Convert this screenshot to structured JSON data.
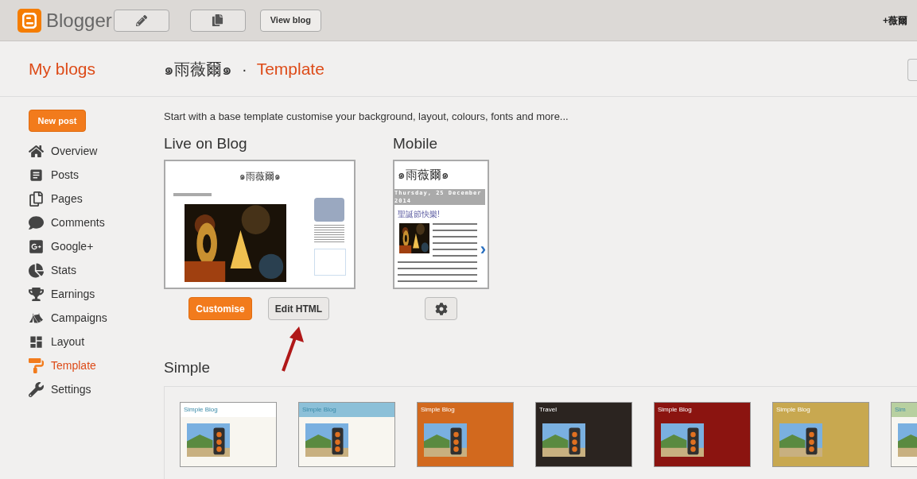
{
  "top_bar": {
    "logo_text": "Blogger",
    "buttons": [
      {
        "kind": "pencil"
      },
      {
        "kind": "pages"
      },
      {
        "kind": "text",
        "label": "View blog"
      }
    ],
    "user": "+薇爾"
  },
  "header": {
    "my_blogs": "My blogs",
    "blog_name": "๑雨薇爾๑",
    "separator": "·",
    "page_title": "Template"
  },
  "sidebar": {
    "new_post": "New post",
    "items": [
      {
        "label": "Overview",
        "selected": false
      },
      {
        "label": "Posts",
        "selected": false
      },
      {
        "label": "Pages",
        "selected": false
      },
      {
        "label": "Comments",
        "selected": false
      },
      {
        "label": "Google+",
        "selected": false
      },
      {
        "label": "Stats",
        "selected": false
      },
      {
        "label": "Earnings",
        "selected": false
      },
      {
        "label": "Campaigns",
        "selected": false
      },
      {
        "label": "Layout",
        "selected": false
      },
      {
        "label": "Template",
        "selected": true
      },
      {
        "label": "Settings",
        "selected": false
      }
    ]
  },
  "intro": "Start with a base template customise your background, layout, colours, fonts and more...",
  "live": {
    "heading": "Live on Blog",
    "preview_title": "๑雨薇爾๑",
    "buttons": [
      "Customise",
      "Edit HTML"
    ]
  },
  "mobile": {
    "heading": "Mobile",
    "preview_title": "๑雨薇爾๑",
    "date": "Thursday, 25 December 2014",
    "post_title": "聖誕節快樂!",
    "next": "›"
  },
  "templates": {
    "heading": "Simple",
    "items": [
      {
        "title": "Simple Blog",
        "color": "#ffffff"
      },
      {
        "title": "Simple Blog",
        "color": "#8cc0d8"
      },
      {
        "title": "Simple Blog",
        "color": "#d2691e"
      },
      {
        "title": "Travel",
        "color": "#2b2420"
      },
      {
        "title": "Simple Blog",
        "color": "#8b1410"
      },
      {
        "title": "Simple Blog",
        "color": "#c8a850"
      },
      {
        "title": "Sim",
        "color": "#b8d0a0"
      }
    ]
  }
}
